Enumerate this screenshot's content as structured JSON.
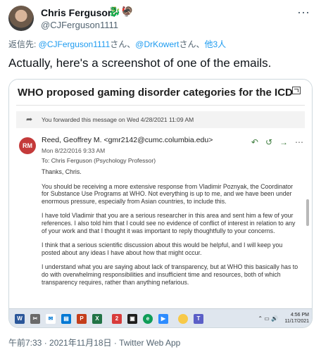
{
  "tweet": {
    "author_name": "Chris Ferguson",
    "emoji_badges": "🐉🦃",
    "handle": "@CJFerguson1111",
    "reply_prefix": "返信先: ",
    "reply_mention_1": "@CJFerguson1111",
    "reply_sep_1": "さん、",
    "reply_mention_2": "@DrKowert",
    "reply_sep_2": "さん、",
    "reply_others": "他3人",
    "text": "Actually, here's a screenshot of one of the emails.",
    "timestamp": "午前7:33 · 2021年11月18日 · Twitter Web App"
  },
  "email": {
    "subject": "WHO proposed gaming disorder categories for the ICD",
    "forward_banner": "You forwarded this message on Wed 4/28/2021 11:09 AM",
    "sender_initials": "RM",
    "sender": "Reed, Geoffrey M. <gmr2142@cumc.columbia.edu>",
    "sent_date": "Mon 8/22/2016 9:33 AM",
    "to": "To:  Chris Ferguson (Psychology Professor)",
    "greeting": "Thanks, Chris.",
    "paragraphs": [
      "You should be receiving a more extensive response from Vladimir Poznyak, the Coordinator for Substance Use Programs at WHO. Not everything is up to me, and we have been under enormous pressure, especially from Asian countries, to include this.",
      "I have told Vladimir that you are a serious researcher in this area and sent him a few of your references.  I also told him that I could see no evidence of conflict of interest in relation to any of your work and that I thought it was important to reply thoughtfully to your concerns.",
      "I think that a serious scientific discussion about this would be helpful, and I will keep you posted about any ideas I have about how that might occur.",
      "I understand what you are saying about lack of transparency, but at WHO this basically has to do with overwhelming responsibilities and insufficient time and resources, both of which transparency requires, rather than anything nefarious."
    ]
  },
  "taskbar": {
    "time": "4:56 PM",
    "date": "11/17/2021"
  },
  "icons": {
    "more": "more-icon",
    "popout": "popout-icon",
    "reply": "reply-icon",
    "reply_all": "reply-all-icon",
    "forward": "forward-icon"
  },
  "colors": {
    "link": "#1d9bf0",
    "sender_avatar": "#c43a3a",
    "taskbar": "#dfe6ee"
  }
}
